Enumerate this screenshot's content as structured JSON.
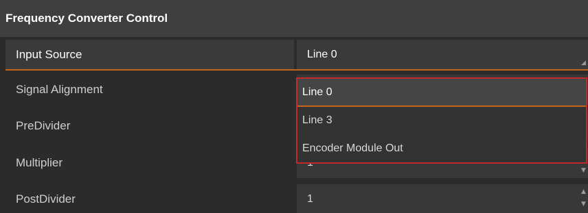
{
  "panel": {
    "title": "Frequency Converter Control"
  },
  "rows": [
    {
      "label": "Input Source",
      "value": "Line 0"
    },
    {
      "label": "Signal Alignment",
      "value": ""
    },
    {
      "label": "PreDivider",
      "value": ""
    },
    {
      "label": "Multiplier",
      "value": "1"
    },
    {
      "label": "PostDivider",
      "value": "1"
    }
  ],
  "dropdown": {
    "options": [
      "Line 0",
      "Line 3",
      "Encoder Module Out"
    ],
    "selected": "Line 0"
  },
  "colors": {
    "accent": "#c86419",
    "dropdown_border": "#c02a2a"
  }
}
